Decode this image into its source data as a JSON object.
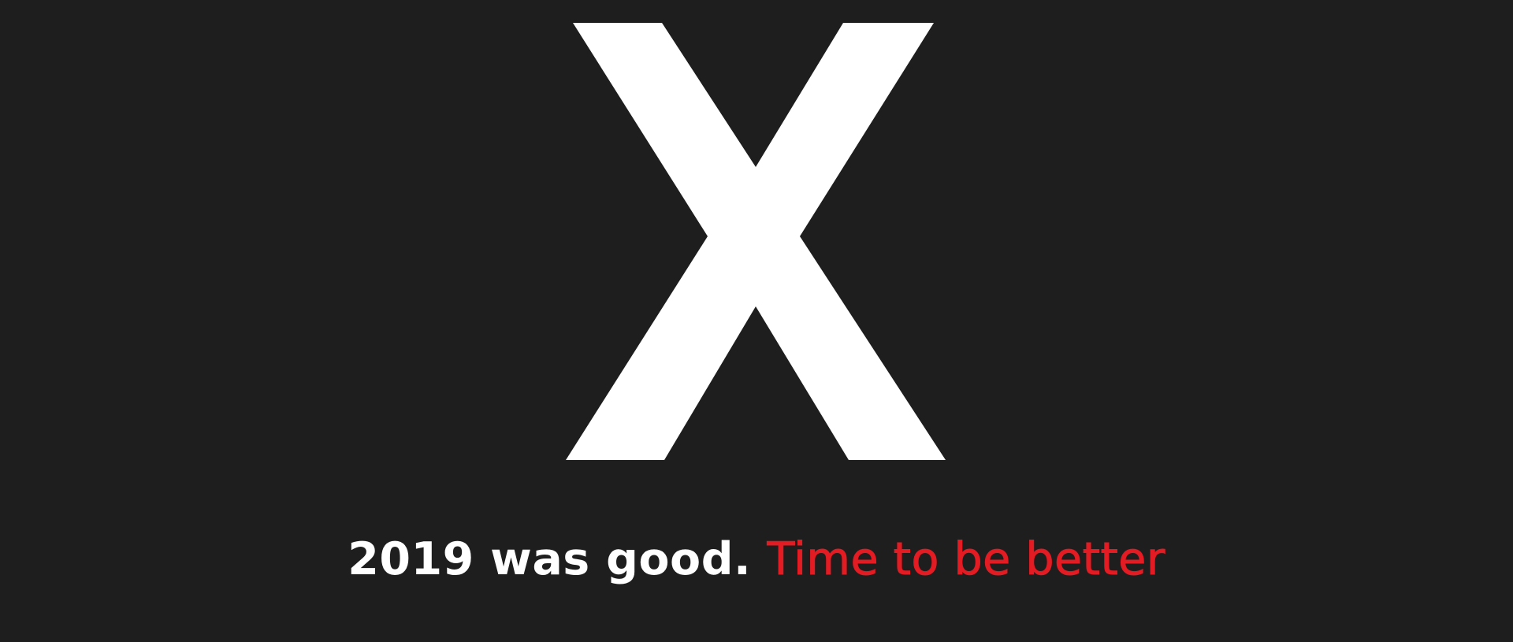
{
  "logo": {
    "letter": "X",
    "color": "#ffffff"
  },
  "tagline": {
    "white_text": "2019 was good.",
    "red_text": "Time to be better",
    "white_color": "#ffffff",
    "red_color": "#e31b23"
  },
  "background_color": "#1e1e1e"
}
